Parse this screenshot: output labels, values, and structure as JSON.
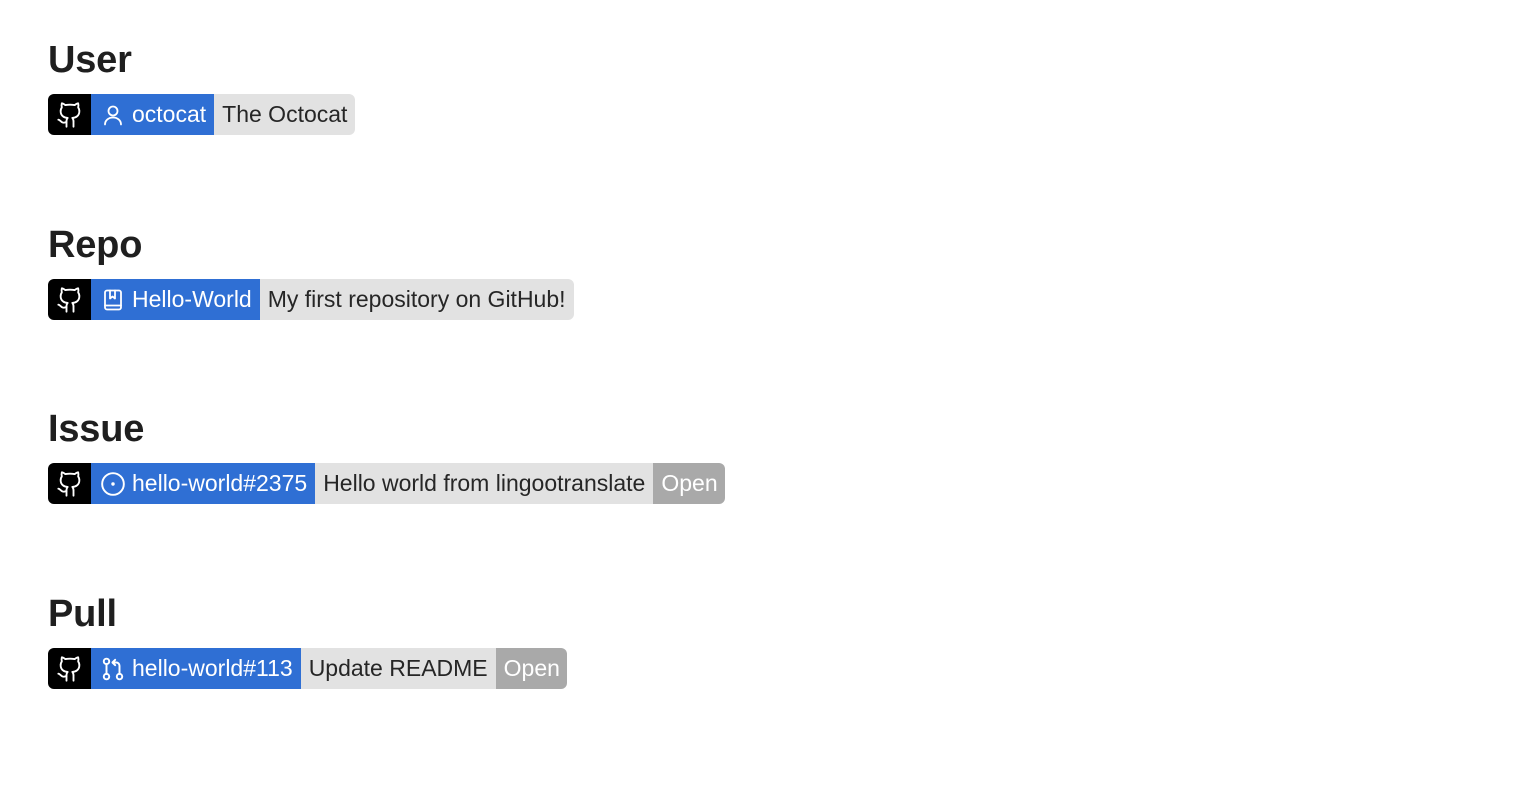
{
  "sections": {
    "user": {
      "heading": "User",
      "id_icon": "person-icon",
      "id_text": "octocat",
      "title": "The Octocat"
    },
    "repo": {
      "heading": "Repo",
      "id_icon": "repo-book-icon",
      "id_text": "Hello-World",
      "title": "My first repository on GitHub!"
    },
    "issue": {
      "heading": "Issue",
      "id_icon": "issue-opened-icon",
      "id_text": "hello-world#2375",
      "title": "Hello world from lingootranslate",
      "state": "Open"
    },
    "pull": {
      "heading": "Pull",
      "id_icon": "pull-request-icon",
      "id_text": "hello-world#113",
      "title": "Update README",
      "state": "Open"
    }
  },
  "logo_icon": "github-octocat-icon",
  "colors": {
    "logo_bg": "#000000",
    "id_bg": "#2f6fd4",
    "title_bg": "#e2e2e2",
    "state_bg": "#a9a9a9",
    "heading_text": "#1f1f1f"
  }
}
